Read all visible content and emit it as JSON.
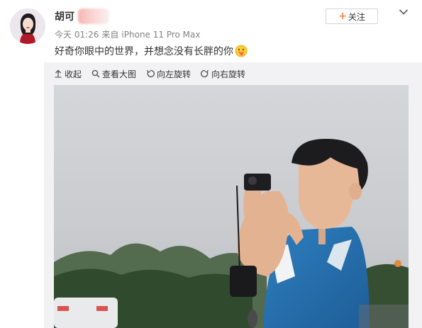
{
  "user": {
    "name": "胡可"
  },
  "follow_button": {
    "label": "关注"
  },
  "post": {
    "time": "今天 01:26",
    "source_prefix": "来自",
    "device": "iPhone 11 Pro Max",
    "text": "好奇你眼中的世界，并想念没有长胖的你"
  },
  "media_toolbar": {
    "items": [
      {
        "label": "收起",
        "icon": "collapse-arrow-icon"
      },
      {
        "label": "查看大图",
        "icon": "magnifier-icon"
      },
      {
        "label": "向左旋转",
        "icon": "rotate-left-icon"
      },
      {
        "label": "向右旋转",
        "icon": "rotate-right-icon"
      }
    ]
  },
  "colors": {
    "accent": "#ff8140",
    "meta_text": "#808080",
    "panel_bg": "#f2f2f5"
  }
}
